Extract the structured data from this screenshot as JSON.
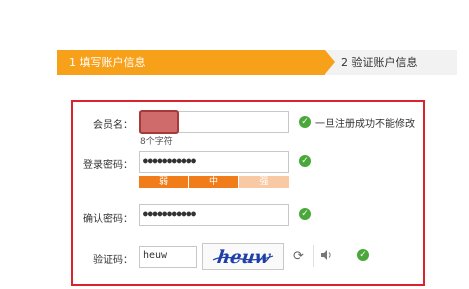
{
  "steps": {
    "step1": "1 填写账户信息",
    "step2": "2 验证账户信息"
  },
  "form": {
    "member_label": "会员名：",
    "member_hint": "8个字符",
    "member_check_hint": "一旦注册成功不能修改",
    "password_label": "登录密码：",
    "password_value": "●●●●●●●●●●●",
    "strength": {
      "weak": "弱",
      "medium": "中",
      "strong": "强",
      "level": "medium"
    },
    "confirm_label": "确认密码：",
    "confirm_value": "●●●●●●●●●●●",
    "captcha_label": "验证码：",
    "captcha_value": "heuw",
    "captcha_image_text": "heuw"
  },
  "icons": {
    "check": "check-circle-icon",
    "refresh": "refresh-icon",
    "audio": "speaker-icon"
  },
  "colors": {
    "accent": "#f7a01a",
    "panel_border": "#d9232e",
    "check": "#4aa83a",
    "strength_weak": "#f07c1a",
    "strength_medium": "#f07c1a",
    "strength_strong": "#f9c9a3"
  }
}
